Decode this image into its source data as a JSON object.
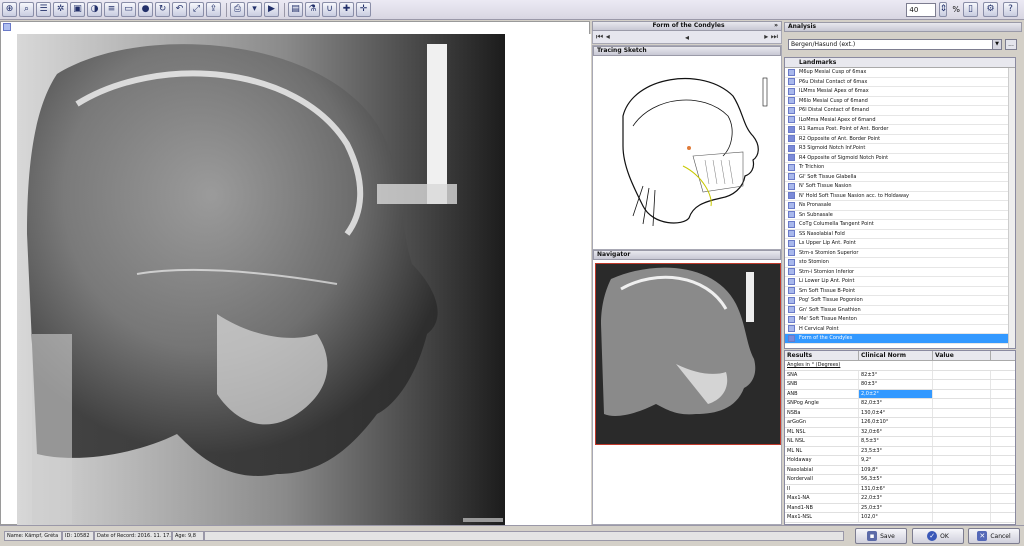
{
  "toolbar": {
    "left_icons": [
      "zoom-in-icon",
      "zoom-out-icon",
      "fit-icon",
      "settings-icon",
      "pan-icon",
      "contrast-icon",
      "list-icon",
      "car-icon",
      "circle-icon",
      "rotate-icon",
      "undo-icon",
      "fullscreen-icon",
      "export-icon",
      "print-icon",
      "dropdown-icon",
      "play-icon",
      "image-icon",
      "filter-icon",
      "magnet-icon",
      "add-point-icon",
      "add-measure-icon"
    ],
    "zoom_value": "40",
    "zoom_unit": "%",
    "right_icons": [
      "page-icon",
      "gear-icon",
      "help-icon"
    ]
  },
  "condyles_panel": {
    "title": "Form of the Condyles"
  },
  "tracing": {
    "title": "Tracing Sketch"
  },
  "navigator": {
    "title": "Navigator"
  },
  "analysis": {
    "title": "Analysis",
    "selected": "Bergen/Hasund (ext.)",
    "browse_label": "..."
  },
  "landmarks": {
    "title": "Landmarks",
    "items": [
      {
        "label": "M6up Mesial Cusp of 6max",
        "checked": false
      },
      {
        "label": "P6u Distal Contact of 6max",
        "checked": false
      },
      {
        "label": "ILMms Mesial Apex of 6max",
        "checked": false
      },
      {
        "label": "M6lo Mesial Cusp of 6mand",
        "checked": false
      },
      {
        "label": "P6l Distal Contact of 6mand",
        "checked": false
      },
      {
        "label": "ILoMma Mesial Apex of 6mand",
        "checked": false
      },
      {
        "label": "R1 Ramus Post. Point of Ant. Border",
        "checked": true
      },
      {
        "label": "R2 Opposite of Ant. Border Point",
        "checked": true
      },
      {
        "label": "R3 Sigmoid Notch Inf.Point",
        "checked": true
      },
      {
        "label": "R4 Opposite of Sigmoid Notch Point",
        "checked": true
      },
      {
        "label": "Tr Trichion",
        "checked": false
      },
      {
        "label": "Gl' Soft Tissue Glabella",
        "checked": false
      },
      {
        "label": "N' Soft Tissue Nasion",
        "checked": false
      },
      {
        "label": "N' Hold Soft Tissue Nasion acc. to Holdaway",
        "checked": true
      },
      {
        "label": "Ns Pronasale",
        "checked": false
      },
      {
        "label": "Sn Subnasale",
        "checked": false
      },
      {
        "label": "CoTg Columella Tangent Point",
        "checked": false
      },
      {
        "label": "SS Nasolabial Fold",
        "checked": false
      },
      {
        "label": "Ls Upper Lip Ant. Point",
        "checked": false
      },
      {
        "label": "Stm-s Stomion Superior",
        "checked": false
      },
      {
        "label": "sto Stomion",
        "checked": false
      },
      {
        "label": "Stm-i Stomion Inferior",
        "checked": false
      },
      {
        "label": "Li Lower Lip Ant. Point",
        "checked": false
      },
      {
        "label": "Sm Soft Tissue B-Point",
        "checked": false
      },
      {
        "label": "Pog' Soft Tissue Pogonion",
        "checked": false
      },
      {
        "label": "Gn' Soft Tissue Gnathion",
        "checked": false
      },
      {
        "label": "Me' Soft Tissue Menton",
        "checked": false
      },
      {
        "label": "H Cervical Point",
        "checked": false
      },
      {
        "label": "Form of the Condyles",
        "checked": true,
        "selected": true
      }
    ]
  },
  "results": {
    "columns": [
      "Results",
      "Clinical Norm",
      "Value"
    ],
    "group": "Angles in ° (Degrees)",
    "rows": [
      {
        "name": "SNA",
        "norm": "82±3°",
        "value": ""
      },
      {
        "name": "SNB",
        "norm": "80±3°",
        "value": ""
      },
      {
        "name": "ANB",
        "norm": "2,0±2°",
        "value": "",
        "highlight": true
      },
      {
        "name": "SNPog Angle",
        "norm": "82,0±3°",
        "value": ""
      },
      {
        "name": "NSBa",
        "norm": "130,0±4°",
        "value": ""
      },
      {
        "name": "arGoGn",
        "norm": "126,0±10°",
        "value": ""
      },
      {
        "name": "ML NSL",
        "norm": "32,0±6°",
        "value": ""
      },
      {
        "name": "NL NSL",
        "norm": "8,5±3°",
        "value": ""
      },
      {
        "name": "ML NL",
        "norm": "23,5±3°",
        "value": ""
      },
      {
        "name": "Holdaway",
        "norm": "9,2°",
        "value": ""
      },
      {
        "name": "Nasolabial",
        "norm": "109,8°",
        "value": ""
      },
      {
        "name": "Nordervall",
        "norm": "56,3±5°",
        "value": ""
      },
      {
        "name": "II",
        "norm": "131,0±6°",
        "value": ""
      },
      {
        "name": "Max1-NA",
        "norm": "22,0±3°",
        "value": ""
      },
      {
        "name": "Mand1-NB",
        "norm": "25,0±3°",
        "value": ""
      },
      {
        "name": "Max1-NSL",
        "norm": "102,0°",
        "value": ""
      }
    ]
  },
  "status": {
    "name": "Name: Kämpf, Gréta",
    "id": "ID: 10582",
    "date": "Date of Record: 2016. 11. 17.",
    "age": "Age: 9,8"
  },
  "buttons": {
    "save": "Save",
    "ok": "OK",
    "cancel": "Cancel"
  },
  "colors": {
    "selection": "#3399ff",
    "toolbar_bg": "#d8d6e2",
    "navigator_border": "#c0392b"
  }
}
